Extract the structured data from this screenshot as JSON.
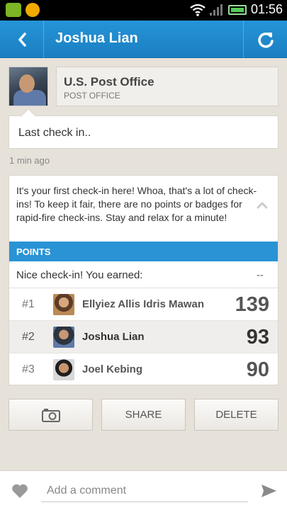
{
  "status_bar": {
    "time": "01:56"
  },
  "header": {
    "title": "Joshua Lian"
  },
  "venue": {
    "name": "U.S. Post Office",
    "category": "POST OFFICE"
  },
  "last_checkin": {
    "text": "Last check in..",
    "time_ago": "1 min ago"
  },
  "message": "It's your first check-in here! Whoa, that's a lot of check-ins! To keep it fair, there are no points or badges for rapid-fire check-ins. Stay and relax for a minute!",
  "points": {
    "header": "POINTS",
    "earned_label": "Nice check-in! You earned:",
    "earned_value": "--",
    "leaderboard": [
      {
        "rank": "#1",
        "name": "Ellyiez Allis Idris Mawan",
        "score": "139"
      },
      {
        "rank": "#2",
        "name": "Joshua Lian",
        "score": "93"
      },
      {
        "rank": "#3",
        "name": "Joel Kebing",
        "score": "90"
      }
    ]
  },
  "actions": {
    "share": "SHARE",
    "delete": "DELETE"
  },
  "comment": {
    "placeholder": "Add a comment"
  },
  "colors": {
    "accent": "#2a93d5",
    "action_bar": "#1a7fc1",
    "background": "#e6e2da"
  }
}
